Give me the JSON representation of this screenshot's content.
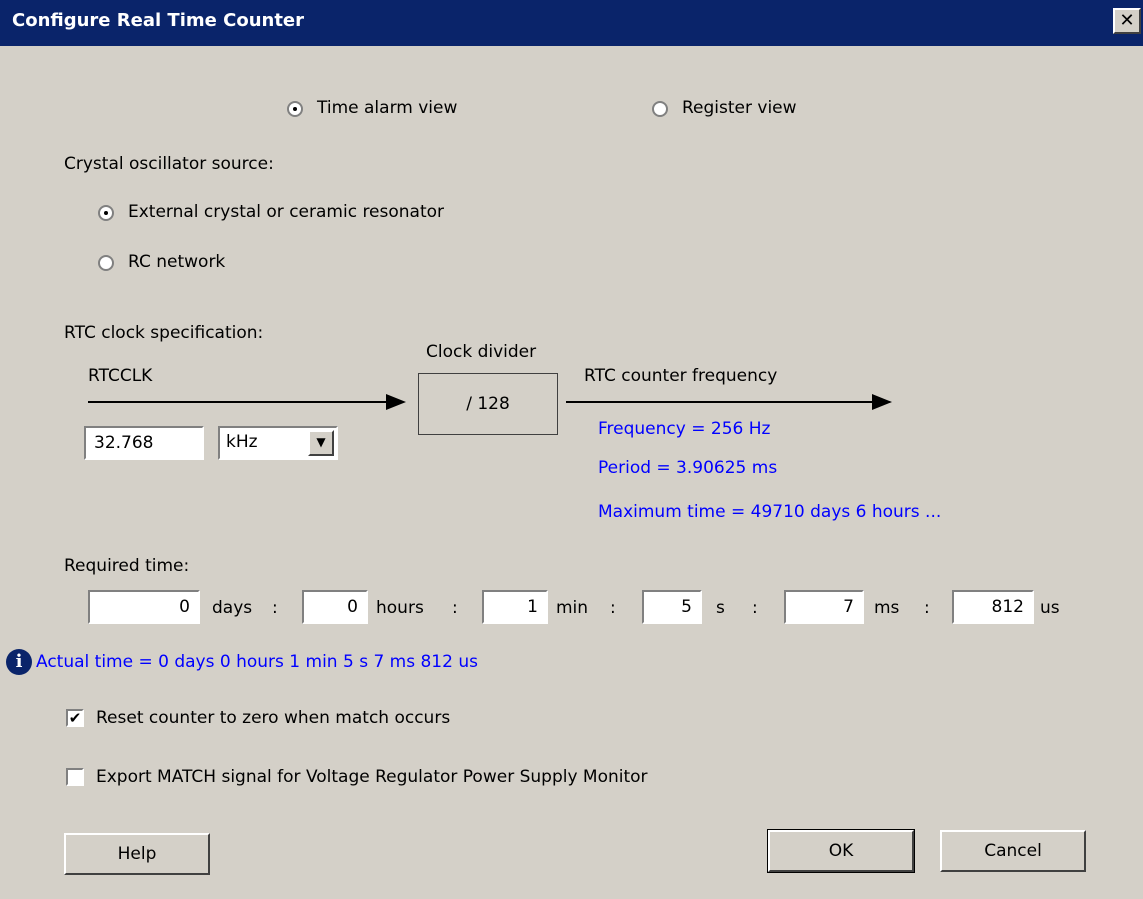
{
  "window": {
    "title": "Configure Real Time Counter",
    "close_label": "✕"
  },
  "view": {
    "time_alarm_label": "Time alarm view",
    "register_label": "Register view",
    "selected": "time_alarm"
  },
  "oscillator": {
    "heading": "Crystal oscillator source:",
    "external_label": "External crystal or ceramic resonator",
    "rc_label": "RC network",
    "selected": "external"
  },
  "rtc_spec": {
    "heading": "RTC clock specification:",
    "rtcclk_label": "RTCCLK",
    "rtcclk_value": "32.768",
    "unit_value": "kHz",
    "divider_label": "Clock divider",
    "divider_value": "/ 128",
    "counter_label": "RTC counter frequency",
    "frequency_text": "Frequency = 256 Hz",
    "period_text": "Period = 3.90625 ms",
    "max_time_text": "Maximum time = 49710 days 6 hours ..."
  },
  "required_time": {
    "heading": "Required time:",
    "days_value": "0",
    "days_unit": "days",
    "hours_value": "0",
    "hours_unit": "hours",
    "min_value": "1",
    "min_unit": "min",
    "s_value": "5",
    "s_unit": "s",
    "ms_value": "7",
    "ms_unit": "ms",
    "us_value": "812",
    "us_unit": "us",
    "separator": ":",
    "actual_text": "Actual time = 0 days 0 hours 1 min 5 s 7 ms 812 us"
  },
  "options": {
    "reset_label": "Reset counter to zero when match occurs",
    "reset_checked": true,
    "export_label": "Export MATCH signal for Voltage Regulator Power Supply Monitor",
    "export_checked": false
  },
  "buttons": {
    "help": "Help",
    "ok": "OK",
    "cancel": "Cancel"
  },
  "icons": {
    "info": "info-icon",
    "dropdown": "chevron-down-icon"
  },
  "colors": {
    "titlebar": "#0a246a",
    "info_text": "#0000ff",
    "dialog_bg": "#d4d0c8"
  }
}
